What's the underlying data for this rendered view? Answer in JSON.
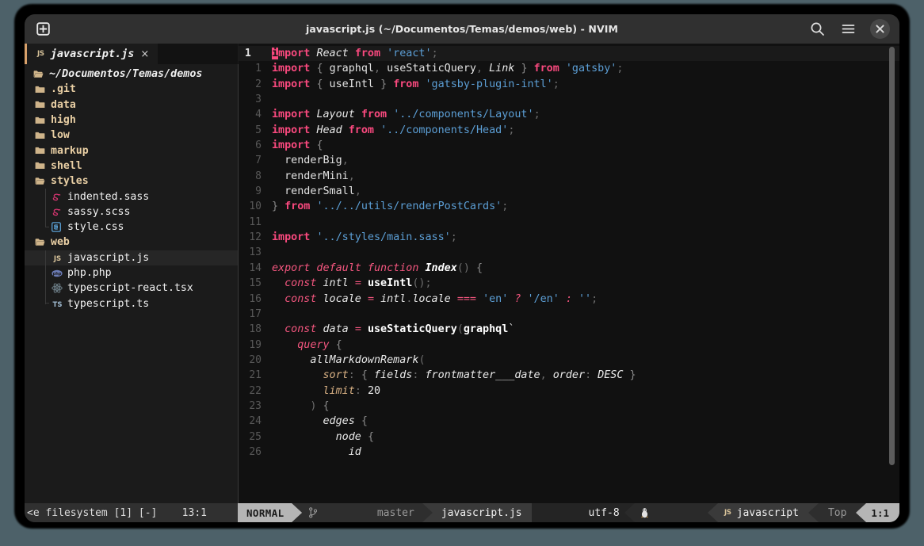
{
  "window": {
    "title": "javascript.js (~/Documentos/Temas/demos/web) - NVIM",
    "new_tab_icon": "new-tab-icon",
    "search_icon": "search-icon",
    "menu_icon": "hamburger-menu-icon",
    "close_icon": "close-icon",
    "background_color": "#4d6169",
    "chrome_color": "#303030"
  },
  "tabline": {
    "tab": {
      "icon": "JS",
      "icon_name": "javascript-file-icon",
      "label": "javascript.js",
      "close": "×",
      "accent_color": "#d7a06a"
    }
  },
  "sidebar": {
    "root": {
      "label": "~/Documentos/Temas/demos",
      "icon": "folder-open-icon"
    },
    "items": [
      {
        "label": ".git",
        "type": "folder",
        "icon": "folder-icon",
        "depth": 1,
        "selected": false
      },
      {
        "label": "data",
        "type": "folder",
        "icon": "folder-icon",
        "depth": 1,
        "selected": false
      },
      {
        "label": "high",
        "type": "folder",
        "icon": "folder-icon",
        "depth": 1,
        "selected": false
      },
      {
        "label": "low",
        "type": "folder",
        "icon": "folder-icon",
        "depth": 1,
        "selected": false
      },
      {
        "label": "markup",
        "type": "folder",
        "icon": "folder-icon",
        "depth": 1,
        "selected": false
      },
      {
        "label": "shell",
        "type": "folder",
        "icon": "folder-icon",
        "depth": 1,
        "selected": false
      },
      {
        "label": "styles",
        "type": "folder",
        "icon": "folder-open-icon",
        "depth": 1,
        "selected": false
      },
      {
        "label": "indented.sass",
        "type": "file",
        "icon": "sass-file-icon",
        "depth": 2,
        "selected": false
      },
      {
        "label": "sassy.scss",
        "type": "file",
        "icon": "sass-file-icon",
        "depth": 2,
        "selected": false
      },
      {
        "label": "style.css",
        "type": "file",
        "icon": "css-file-icon",
        "depth": 2,
        "selected": false,
        "last": true
      },
      {
        "label": "web",
        "type": "folder",
        "icon": "folder-open-icon",
        "depth": 1,
        "selected": false
      },
      {
        "label": "javascript.js",
        "type": "file",
        "icon": "javascript-file-icon",
        "depth": 2,
        "selected": true
      },
      {
        "label": "php.php",
        "type": "file",
        "icon": "php-file-icon",
        "depth": 2,
        "selected": false
      },
      {
        "label": "typescript-react.tsx",
        "type": "file",
        "icon": "react-file-icon",
        "depth": 2,
        "selected": false
      },
      {
        "label": "typescript.ts",
        "type": "file",
        "icon": "typescript-file-icon",
        "depth": 2,
        "selected": false,
        "last": true
      }
    ]
  },
  "editor": {
    "filetype": "javascript",
    "cursor_char": "i",
    "lines": [
      {
        "num": "1",
        "current": true,
        "tokens": [
          {
            "t": "i",
            "c": "cursor"
          },
          {
            "t": "mport",
            "c": "kw"
          },
          {
            "t": " ",
            "c": "plain"
          },
          {
            "t": "React",
            "c": "id"
          },
          {
            "t": " ",
            "c": "plain"
          },
          {
            "t": "from",
            "c": "kw"
          },
          {
            "t": " ",
            "c": "plain"
          },
          {
            "t": "'react'",
            "c": "str"
          },
          {
            "t": ";",
            "c": "pun"
          }
        ]
      },
      {
        "num": "1",
        "current": false,
        "tokens": [
          {
            "t": "import",
            "c": "kw"
          },
          {
            "t": " ",
            "c": "plain"
          },
          {
            "t": "{",
            "c": "punl"
          },
          {
            "t": " ",
            "c": "plain"
          },
          {
            "t": "graphql",
            "c": "plain"
          },
          {
            "t": ",",
            "c": "pun"
          },
          {
            "t": " useStaticQuery",
            "c": "plain"
          },
          {
            "t": ",",
            "c": "pun"
          },
          {
            "t": " ",
            "c": "plain"
          },
          {
            "t": "Link",
            "c": "id"
          },
          {
            "t": " ",
            "c": "plain"
          },
          {
            "t": "}",
            "c": "punl"
          },
          {
            "t": " ",
            "c": "plain"
          },
          {
            "t": "from",
            "c": "kw"
          },
          {
            "t": " ",
            "c": "plain"
          },
          {
            "t": "'gatsby'",
            "c": "str"
          },
          {
            "t": ";",
            "c": "pun"
          }
        ]
      },
      {
        "num": "2",
        "current": false,
        "tokens": [
          {
            "t": "import",
            "c": "kw"
          },
          {
            "t": " ",
            "c": "plain"
          },
          {
            "t": "{",
            "c": "punl"
          },
          {
            "t": " useIntl ",
            "c": "plain"
          },
          {
            "t": "}",
            "c": "punl"
          },
          {
            "t": " ",
            "c": "plain"
          },
          {
            "t": "from",
            "c": "kw"
          },
          {
            "t": " ",
            "c": "plain"
          },
          {
            "t": "'gatsby-plugin-intl'",
            "c": "str"
          },
          {
            "t": ";",
            "c": "pun"
          }
        ]
      },
      {
        "num": "3",
        "current": false,
        "tokens": []
      },
      {
        "num": "4",
        "current": false,
        "tokens": [
          {
            "t": "import",
            "c": "kw"
          },
          {
            "t": " ",
            "c": "plain"
          },
          {
            "t": "Layout",
            "c": "id"
          },
          {
            "t": " ",
            "c": "plain"
          },
          {
            "t": "from",
            "c": "kw"
          },
          {
            "t": " ",
            "c": "plain"
          },
          {
            "t": "'../components/Layout'",
            "c": "str"
          },
          {
            "t": ";",
            "c": "pun"
          }
        ]
      },
      {
        "num": "5",
        "current": false,
        "tokens": [
          {
            "t": "import",
            "c": "kw"
          },
          {
            "t": " ",
            "c": "plain"
          },
          {
            "t": "Head",
            "c": "id"
          },
          {
            "t": " ",
            "c": "plain"
          },
          {
            "t": "from",
            "c": "kw"
          },
          {
            "t": " ",
            "c": "plain"
          },
          {
            "t": "'../components/Head'",
            "c": "str"
          },
          {
            "t": ";",
            "c": "pun"
          }
        ]
      },
      {
        "num": "6",
        "current": false,
        "tokens": [
          {
            "t": "import",
            "c": "kw"
          },
          {
            "t": " ",
            "c": "plain"
          },
          {
            "t": "{",
            "c": "punl"
          }
        ]
      },
      {
        "num": "7",
        "current": false,
        "tokens": [
          {
            "t": "  renderBig",
            "c": "plain"
          },
          {
            "t": ",",
            "c": "pun"
          }
        ]
      },
      {
        "num": "8",
        "current": false,
        "tokens": [
          {
            "t": "  renderMini",
            "c": "plain"
          },
          {
            "t": ",",
            "c": "pun"
          }
        ]
      },
      {
        "num": "9",
        "current": false,
        "tokens": [
          {
            "t": "  renderSmall",
            "c": "plain"
          },
          {
            "t": ",",
            "c": "pun"
          }
        ]
      },
      {
        "num": "10",
        "current": false,
        "tokens": [
          {
            "t": "}",
            "c": "punl"
          },
          {
            "t": " ",
            "c": "plain"
          },
          {
            "t": "from",
            "c": "kw"
          },
          {
            "t": " ",
            "c": "plain"
          },
          {
            "t": "'../../utils/renderPostCards'",
            "c": "str"
          },
          {
            "t": ";",
            "c": "pun"
          }
        ]
      },
      {
        "num": "11",
        "current": false,
        "tokens": []
      },
      {
        "num": "12",
        "current": false,
        "tokens": [
          {
            "t": "import",
            "c": "kw"
          },
          {
            "t": " ",
            "c": "plain"
          },
          {
            "t": "'../styles/main.sass'",
            "c": "str"
          },
          {
            "t": ";",
            "c": "pun"
          }
        ]
      },
      {
        "num": "13",
        "current": false,
        "tokens": []
      },
      {
        "num": "14",
        "current": false,
        "tokens": [
          {
            "t": "export default function",
            "c": "kwi"
          },
          {
            "t": " ",
            "c": "plain"
          },
          {
            "t": "Index",
            "c": "idb"
          },
          {
            "t": "()",
            "c": "pun"
          },
          {
            "t": " ",
            "c": "plain"
          },
          {
            "t": "{",
            "c": "punl"
          }
        ]
      },
      {
        "num": "15",
        "current": false,
        "tokens": [
          {
            "t": "  ",
            "c": "plain"
          },
          {
            "t": "const",
            "c": "kwi"
          },
          {
            "t": " ",
            "c": "plain"
          },
          {
            "t": "intl",
            "c": "id"
          },
          {
            "t": " ",
            "c": "plain"
          },
          {
            "t": "=",
            "c": "kwi"
          },
          {
            "t": " ",
            "c": "plain"
          },
          {
            "t": "useIntl",
            "c": "fn"
          },
          {
            "t": "()",
            "c": "pun"
          },
          {
            "t": ";",
            "c": "pun"
          }
        ]
      },
      {
        "num": "16",
        "current": false,
        "tokens": [
          {
            "t": "  ",
            "c": "plain"
          },
          {
            "t": "const",
            "c": "kwi"
          },
          {
            "t": " ",
            "c": "plain"
          },
          {
            "t": "locale",
            "c": "id"
          },
          {
            "t": " ",
            "c": "plain"
          },
          {
            "t": "=",
            "c": "kwi"
          },
          {
            "t": " ",
            "c": "plain"
          },
          {
            "t": "intl",
            "c": "id"
          },
          {
            "t": ".",
            "c": "pun"
          },
          {
            "t": "locale",
            "c": "id"
          },
          {
            "t": " ",
            "c": "plain"
          },
          {
            "t": "===",
            "c": "kwi"
          },
          {
            "t": " ",
            "c": "plain"
          },
          {
            "t": "'en'",
            "c": "str"
          },
          {
            "t": " ",
            "c": "plain"
          },
          {
            "t": "?",
            "c": "kwi"
          },
          {
            "t": " ",
            "c": "plain"
          },
          {
            "t": "'/en'",
            "c": "str"
          },
          {
            "t": " ",
            "c": "plain"
          },
          {
            "t": ":",
            "c": "kwi"
          },
          {
            "t": " ",
            "c": "plain"
          },
          {
            "t": "''",
            "c": "str"
          },
          {
            "t": ";",
            "c": "pun"
          }
        ]
      },
      {
        "num": "17",
        "current": false,
        "tokens": []
      },
      {
        "num": "18",
        "current": false,
        "tokens": [
          {
            "t": "  ",
            "c": "plain"
          },
          {
            "t": "const",
            "c": "kwi"
          },
          {
            "t": " ",
            "c": "plain"
          },
          {
            "t": "data",
            "c": "id"
          },
          {
            "t": " ",
            "c": "plain"
          },
          {
            "t": "=",
            "c": "kwi"
          },
          {
            "t": " ",
            "c": "plain"
          },
          {
            "t": "useStaticQuery",
            "c": "fn"
          },
          {
            "t": "(",
            "c": "pun"
          },
          {
            "t": "graphql",
            "c": "fn"
          },
          {
            "t": "`",
            "c": "plain"
          }
        ]
      },
      {
        "num": "19",
        "current": false,
        "tokens": [
          {
            "t": "    ",
            "c": "plain"
          },
          {
            "t": "query",
            "c": "kwi"
          },
          {
            "t": " ",
            "c": "plain"
          },
          {
            "t": "{",
            "c": "punl"
          }
        ]
      },
      {
        "num": "20",
        "current": false,
        "tokens": [
          {
            "t": "      ",
            "c": "plain"
          },
          {
            "t": "allMarkdownRemark",
            "c": "id"
          },
          {
            "t": "(",
            "c": "pun"
          }
        ]
      },
      {
        "num": "21",
        "current": false,
        "tokens": [
          {
            "t": "        ",
            "c": "plain"
          },
          {
            "t": "sort",
            "c": "prop"
          },
          {
            "t": ":",
            "c": "pun"
          },
          {
            "t": " ",
            "c": "plain"
          },
          {
            "t": "{",
            "c": "punl"
          },
          {
            "t": " ",
            "c": "plain"
          },
          {
            "t": "fields",
            "c": "id"
          },
          {
            "t": ":",
            "c": "pun"
          },
          {
            "t": " ",
            "c": "plain"
          },
          {
            "t": "frontmatter___date",
            "c": "id"
          },
          {
            "t": ",",
            "c": "pun"
          },
          {
            "t": " ",
            "c": "plain"
          },
          {
            "t": "order",
            "c": "id"
          },
          {
            "t": ":",
            "c": "pun"
          },
          {
            "t": " ",
            "c": "plain"
          },
          {
            "t": "DESC",
            "c": "id"
          },
          {
            "t": " ",
            "c": "plain"
          },
          {
            "t": "}",
            "c": "punl"
          }
        ]
      },
      {
        "num": "22",
        "current": false,
        "tokens": [
          {
            "t": "        ",
            "c": "plain"
          },
          {
            "t": "limit",
            "c": "prop"
          },
          {
            "t": ":",
            "c": "pun"
          },
          {
            "t": " ",
            "c": "plain"
          },
          {
            "t": "20",
            "c": "num"
          }
        ]
      },
      {
        "num": "23",
        "current": false,
        "tokens": [
          {
            "t": "      ",
            "c": "plain"
          },
          {
            "t": ")",
            "c": "pun"
          },
          {
            "t": " ",
            "c": "plain"
          },
          {
            "t": "{",
            "c": "punl"
          }
        ]
      },
      {
        "num": "24",
        "current": false,
        "tokens": [
          {
            "t": "        ",
            "c": "plain"
          },
          {
            "t": "edges",
            "c": "id"
          },
          {
            "t": " ",
            "c": "plain"
          },
          {
            "t": "{",
            "c": "punl"
          }
        ]
      },
      {
        "num": "25",
        "current": false,
        "tokens": [
          {
            "t": "          ",
            "c": "plain"
          },
          {
            "t": "node",
            "c": "id"
          },
          {
            "t": " ",
            "c": "plain"
          },
          {
            "t": "{",
            "c": "punl"
          }
        ]
      },
      {
        "num": "26",
        "current": false,
        "tokens": [
          {
            "t": "            ",
            "c": "plain"
          },
          {
            "t": "id",
            "c": "id"
          }
        ]
      }
    ]
  },
  "statusline": {
    "left": "<e filesystem [1] [-]    13:1",
    "mode": "NORMAL",
    "git_icon": "git-branch-icon",
    "branch": "master",
    "filename": "javascript.js",
    "encoding": "utf-8",
    "os_icon": "linux-penguin-icon",
    "lang_icon": "JS",
    "lang": "javascript",
    "scroll": "Top",
    "position": "1:1"
  }
}
